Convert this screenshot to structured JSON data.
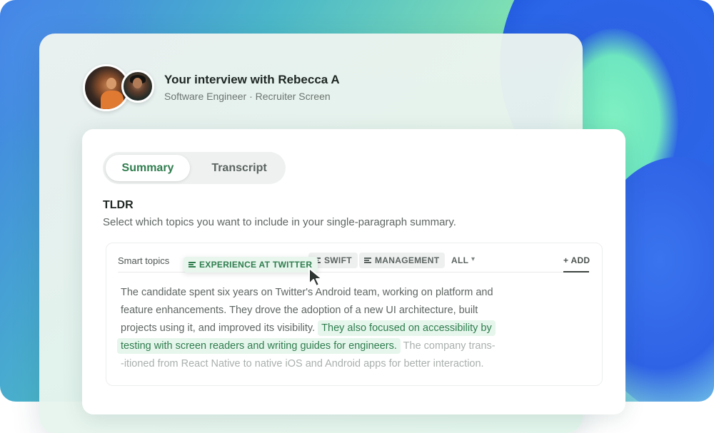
{
  "header": {
    "title": "Your interview with Rebecca A",
    "subtitle": "Software Engineer · Recruiter Screen"
  },
  "tabs": [
    {
      "label": "Summary",
      "active": true
    },
    {
      "label": "Transcript",
      "active": false
    }
  ],
  "section": {
    "heading": "TLDR",
    "description": "Select which topics you want to include in your single-paragraph summary."
  },
  "topics": {
    "label": "Smart topics",
    "chips": [
      {
        "label": "EXPERIENCE AT TWITTER",
        "selected": true
      },
      {
        "label": "SWIFT",
        "selected": false
      },
      {
        "label": "MANAGEMENT",
        "selected": false
      }
    ],
    "all_label": "ALL",
    "add_label": "+ ADD"
  },
  "summary": {
    "line1": "The candidate spent six years on Twitter's Android team, working on platform and",
    "line2": "feature enhancements. They drove the adoption of a new UI architecture, built",
    "line3_plain": "projects using it, and improved its visibility.",
    "line3_highlight": "They also focused on accessibility by",
    "line4_highlight": "testing with screen readers and writing guides for engineers.",
    "line4_faded": "The company trans-",
    "line5": "-itioned from React Native to native iOS and Android apps for better interaction."
  },
  "icons": {
    "chip_icon": "lines-icon",
    "dropdown": "chevron-down-icon",
    "pointer": "cursor-icon"
  },
  "colors": {
    "accent_green": "#2f7d4e",
    "highlight_bg": "#e6f6ec"
  }
}
